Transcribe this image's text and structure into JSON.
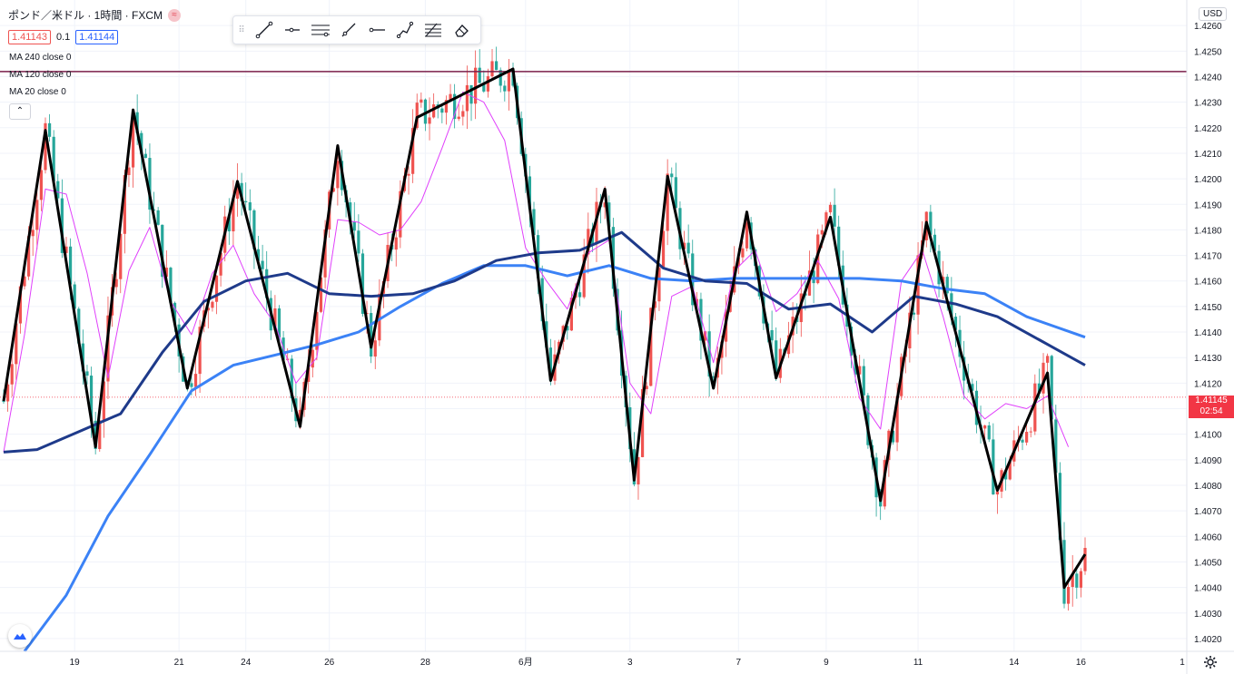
{
  "legend": {
    "symbol_title": "ポンド／米ドル · 1時間 · FXCM",
    "bid": "1.41143",
    "spread": "0.1",
    "ask": "1.41144",
    "ma_240": "MA 240 close 0",
    "ma_120": "MA 120 close 0",
    "ma_20": "MA 20 close 0",
    "collapse_icon": "chevron-up-icon"
  },
  "currency_badge": "USD",
  "last_price": {
    "value": "1.41145",
    "countdown": "02:54"
  },
  "toolbar_icons": [
    "trend-line-icon",
    "horizontal-ray-icon",
    "parallel-channel-icon",
    "ray-icon",
    "horizontal-line-icon",
    "path-icon",
    "fib-icon",
    "eraser-icon"
  ],
  "colors": {
    "up": "#ef5350",
    "down": "#26a69a",
    "zigzag": "#000000",
    "ma20": "#e040fb",
    "ma120": "#1e3a8a",
    "ma240": "#3b82f6",
    "hline": "#7a1f4a",
    "last_price": "#f23645"
  },
  "chart_data": {
    "type": "candlestick",
    "ylim": [
      1.4015,
      1.427
    ],
    "y_ticks": [
      1.402,
      1.403,
      1.404,
      1.405,
      1.406,
      1.407,
      1.408,
      1.409,
      1.41,
      1.411,
      1.412,
      1.413,
      1.414,
      1.415,
      1.416,
      1.417,
      1.418,
      1.419,
      1.42,
      1.421,
      1.422,
      1.423,
      1.424,
      1.425,
      1.426
    ],
    "x_ticks": [
      "19",
      "21",
      "24",
      "26",
      "28",
      "6月",
      "3",
      "7",
      "9",
      "11",
      "14",
      "16"
    ],
    "horizontal_line": 1.4242,
    "current_price": 1.41145,
    "zigzag": [
      [
        0,
        1.4113
      ],
      [
        10,
        1.4219
      ],
      [
        22,
        1.4095
      ],
      [
        31,
        1.4227
      ],
      [
        44,
        1.4118
      ],
      [
        56,
        1.4199
      ],
      [
        71,
        1.4103
      ],
      [
        80,
        1.4213
      ],
      [
        88,
        1.4134
      ],
      [
        99,
        1.4224
      ],
      [
        122,
        1.4243
      ],
      [
        131,
        1.4121
      ],
      [
        144,
        1.4196
      ],
      [
        151,
        1.4082
      ],
      [
        159,
        1.4201
      ],
      [
        170,
        1.4118
      ],
      [
        178,
        1.4187
      ],
      [
        185,
        1.4122
      ],
      [
        198,
        1.4185
      ],
      [
        210,
        1.4074
      ],
      [
        221,
        1.4183
      ],
      [
        238,
        1.4078
      ],
      [
        250,
        1.4124
      ],
      [
        254,
        1.404
      ],
      [
        259,
        1.4053
      ]
    ],
    "ma20": [
      [
        0,
        1.4093
      ],
      [
        5,
        1.4139
      ],
      [
        10,
        1.4196
      ],
      [
        15,
        1.4194
      ],
      [
        20,
        1.4163
      ],
      [
        25,
        1.4122
      ],
      [
        30,
        1.4164
      ],
      [
        35,
        1.4181
      ],
      [
        40,
        1.4152
      ],
      [
        45,
        1.4139
      ],
      [
        50,
        1.4163
      ],
      [
        55,
        1.4174
      ],
      [
        60,
        1.4155
      ],
      [
        65,
        1.4143
      ],
      [
        70,
        1.412
      ],
      [
        75,
        1.413
      ],
      [
        80,
        1.4184
      ],
      [
        85,
        1.4183
      ],
      [
        90,
        1.4178
      ],
      [
        95,
        1.418
      ],
      [
        100,
        1.4191
      ],
      [
        105,
        1.4212
      ],
      [
        110,
        1.4234
      ],
      [
        115,
        1.423
      ],
      [
        120,
        1.4215
      ],
      [
        125,
        1.4173
      ],
      [
        130,
        1.416
      ],
      [
        135,
        1.4149
      ],
      [
        140,
        1.4171
      ],
      [
        145,
        1.4176
      ],
      [
        150,
        1.412
      ],
      [
        155,
        1.4108
      ],
      [
        160,
        1.4154
      ],
      [
        165,
        1.4158
      ],
      [
        170,
        1.4128
      ],
      [
        175,
        1.4164
      ],
      [
        180,
        1.4172
      ],
      [
        185,
        1.4148
      ],
      [
        190,
        1.4155
      ],
      [
        195,
        1.4168
      ],
      [
        200,
        1.4153
      ],
      [
        205,
        1.4114
      ],
      [
        210,
        1.4102
      ],
      [
        215,
        1.416
      ],
      [
        220,
        1.4172
      ],
      [
        225,
        1.4146
      ],
      [
        230,
        1.4115
      ],
      [
        235,
        1.4106
      ],
      [
        240,
        1.4112
      ],
      [
        245,
        1.411
      ],
      [
        250,
        1.4115
      ],
      [
        255,
        1.4095
      ]
    ],
    "ma120": [
      [
        0,
        1.4093
      ],
      [
        8,
        1.4094
      ],
      [
        18,
        1.4101
      ],
      [
        28,
        1.4108
      ],
      [
        38,
        1.4132
      ],
      [
        48,
        1.4152
      ],
      [
        58,
        1.416
      ],
      [
        68,
        1.4163
      ],
      [
        78,
        1.4155
      ],
      [
        88,
        1.4154
      ],
      [
        98,
        1.4155
      ],
      [
        108,
        1.416
      ],
      [
        118,
        1.4168
      ],
      [
        128,
        1.4171
      ],
      [
        138,
        1.4172
      ],
      [
        148,
        1.4179
      ],
      [
        158,
        1.4165
      ],
      [
        168,
        1.416
      ],
      [
        178,
        1.4159
      ],
      [
        188,
        1.4149
      ],
      [
        198,
        1.4151
      ],
      [
        208,
        1.414
      ],
      [
        218,
        1.4154
      ],
      [
        228,
        1.4151
      ],
      [
        238,
        1.4146
      ],
      [
        248,
        1.4137
      ],
      [
        259,
        1.4127
      ]
    ],
    "ma240": [
      [
        5,
        1.4015
      ],
      [
        15,
        1.4037
      ],
      [
        25,
        1.4068
      ],
      [
        35,
        1.4092
      ],
      [
        45,
        1.4117
      ],
      [
        55,
        1.4127
      ],
      [
        65,
        1.4131
      ],
      [
        75,
        1.4135
      ],
      [
        85,
        1.414
      ],
      [
        95,
        1.415
      ],
      [
        105,
        1.4159
      ],
      [
        115,
        1.4166
      ],
      [
        125,
        1.4166
      ],
      [
        135,
        1.4162
      ],
      [
        145,
        1.4166
      ],
      [
        155,
        1.4161
      ],
      [
        165,
        1.416
      ],
      [
        175,
        1.4161
      ],
      [
        185,
        1.4161
      ],
      [
        195,
        1.4161
      ],
      [
        205,
        1.4161
      ],
      [
        215,
        1.416
      ],
      [
        225,
        1.4157
      ],
      [
        235,
        1.4155
      ],
      [
        245,
        1.4146
      ],
      [
        259,
        1.4138
      ]
    ],
    "xlabel": "",
    "ylabel": ""
  }
}
